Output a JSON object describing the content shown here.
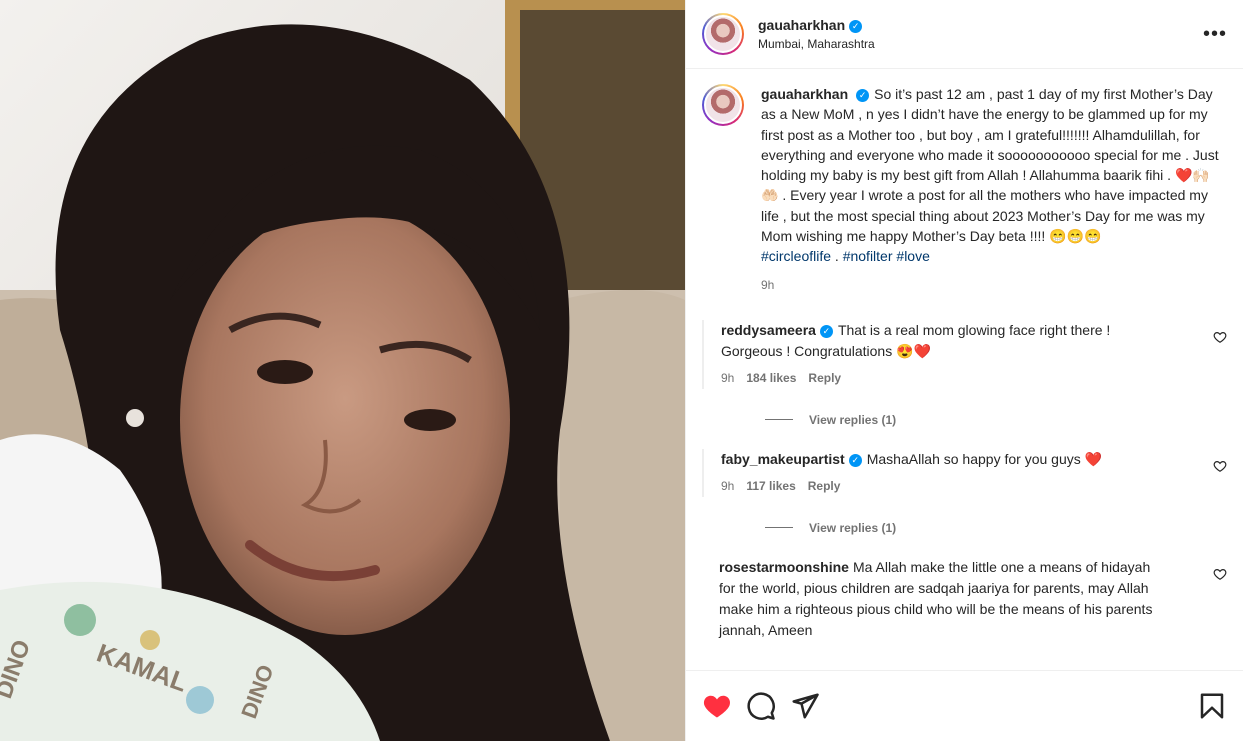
{
  "post": {
    "username": "gauaharkhan",
    "location": "Mumbai, Maharashtra",
    "caption": "So it’s past 12 am , past 1 day of my first Mother’s Day as a New MoM , n yes I didn’t have the energy to be glammed up for my first post as a Mother too , but boy , am I grateful!!!!!!! Alhamdulillah, for everything and everyone who made it sooooooooooo special for me . Just holding my baby is my best gift from Allah ! Allahumma baarik fihi . ❤️🙌🏻🤲🏻 . Every year I wrote a post for all the mothers who have impacted my life , but the most special thing about 2023 Mother’s Day for me was my Mom wishing me happy Mother’s Day beta !!!! 😁😁😁",
    "tags": [
      "#circleoflife",
      "#nofilter",
      "#love"
    ],
    "tag_separator": " . ",
    "time": "9h"
  },
  "comments": [
    {
      "username": "reddysameera",
      "text": "That is a real mom glowing face right there ! Gorgeous ! Congratulations 😍❤️",
      "time": "9h",
      "likes": "184 likes",
      "reply": "Reply",
      "view_replies": "View replies (1)"
    },
    {
      "username": "faby_makeupartist",
      "text": "MashaAllah so happy for you guys ❤️",
      "time": "9h",
      "likes": "117 likes",
      "reply": "Reply",
      "view_replies": "View replies (1)"
    },
    {
      "username": "rosestarmoonshine",
      "text": "Ma Allah make the little one a means of hidayah for the world, pious children are sadqah jaariya for parents, may Allah make him a righteous pious child who will be the means of his parents jannah, Ameen"
    }
  ],
  "icons": {
    "more": "more-options-icon",
    "like": "heart-filled-icon",
    "comment": "comment-icon",
    "share": "share-icon",
    "save": "bookmark-icon",
    "verified": "verified-badge-icon",
    "comment_like": "heart-outline-icon"
  },
  "colors": {
    "like_red": "#ff3040",
    "verified_blue": "#0095f6",
    "hashtag": "#00376b",
    "muted": "#737373"
  }
}
